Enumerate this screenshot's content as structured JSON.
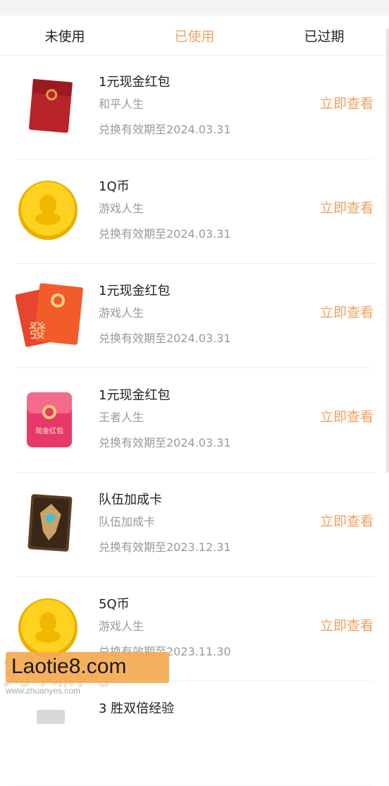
{
  "tabs": [
    "未使用",
    "已使用",
    "已过期"
  ],
  "active_tab": 1,
  "action_label": "立即查看",
  "items": [
    {
      "title": "1元现金红包",
      "source": "和平人生",
      "expiry": "兑换有效期至2024.03.31",
      "icon": "red-envelope-icon"
    },
    {
      "title": "1Q币",
      "source": "游戏人生",
      "expiry": "兑换有效期至2024.03.31",
      "icon": "gold-coin-icon"
    },
    {
      "title": "1元现金红包",
      "source": "游戏人生",
      "expiry": "兑换有效期至2024.03.31",
      "icon": "fa-red-envelope-icon"
    },
    {
      "title": "1元现金红包",
      "source": "王者人生",
      "expiry": "兑换有效期至2024.03.31",
      "icon": "pink-red-envelope-icon",
      "badge": "现金红包"
    },
    {
      "title": "队伍加成卡",
      "source": "队伍加成卡",
      "expiry": "兑换有效期至2023.12.31",
      "icon": "team-bonus-card-icon"
    },
    {
      "title": "5Q币",
      "source": "游戏人生",
      "expiry": "兑换有效期至2023.11.30",
      "icon": "gold-coin-icon"
    },
    {
      "title": "3 胜双倍经验",
      "source": "",
      "expiry": "",
      "icon": "partial-item-icon"
    }
  ],
  "watermark": {
    "big": "好赚网",
    "main": "Laotie8.com",
    "small": "www.zhuanyes.com"
  },
  "colors": {
    "accent": "#f0a060",
    "active_tab": "#f2a36a"
  }
}
